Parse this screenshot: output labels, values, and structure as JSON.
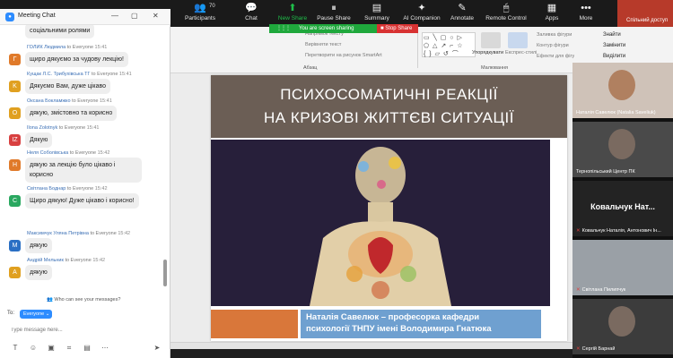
{
  "toolbar": {
    "participants_count": "70",
    "items": [
      {
        "label": "Participants",
        "icon": "👥"
      },
      {
        "label": "Chat",
        "icon": "💬"
      },
      {
        "label": "New Share",
        "icon": "⬆"
      },
      {
        "label": "Pause Share",
        "icon": "⏸"
      },
      {
        "label": "Summary",
        "icon": "▤"
      },
      {
        "label": "AI Companion",
        "icon": "✦"
      },
      {
        "label": "Annotate",
        "icon": "✎"
      },
      {
        "label": "Remote Control",
        "icon": "🖱"
      },
      {
        "label": "Apps",
        "icon": "▦"
      },
      {
        "label": "More",
        "icon": "•••"
      }
    ],
    "share_status": "You are screen sharing",
    "stop_share": "Stop Share",
    "accent": "#1fbf4a",
    "corner_text": "Спільний доступ"
  },
  "ribbon": {
    "para_items": [
      "Напрямок тексту",
      "Вирівняти текст",
      "Перетворити на рисунок SmartArt"
    ],
    "group_paragraph": "Абзац",
    "group_drawing": "Малювання",
    "arrange": "Упорядкувати",
    "quick_styles": "Експрес-стилі",
    "shape_fill": "Заливка фігури",
    "shape_outline": "Контур фігури",
    "shape_effects": "Ефекти для фігур",
    "find": "Знайти",
    "replace": "Замінити",
    "select": "Виділити"
  },
  "chat": {
    "title": "Meeting Chat",
    "messages": [
      {
        "initial": "",
        "color": "#e0a020",
        "sender": "",
        "to": "",
        "time": "",
        "text": "соціальними ролями"
      },
      {
        "initial": "Г",
        "color": "#e07a2a",
        "sender": "ГОЛИК Людмила",
        "to": "to Everyone",
        "time": "15:41",
        "text": "щиро дякуємо за чудову лекцію!"
      },
      {
        "initial": "K",
        "color": "#e0a020",
        "sender": "Кущак Л.С. Трибухівська ТГ",
        "to": "to Everyone",
        "time": "15:41",
        "text": "Дякуємо Вам, дуже цікаво"
      },
      {
        "initial": "О",
        "color": "#e0a020",
        "sender": "Оксана Бокламжко",
        "to": "to Everyone",
        "time": "15:41",
        "text": "дякую, змістовно та корисно"
      },
      {
        "initial": "IZ",
        "color": "#d84040",
        "sender": "Ilona Zolotnyk",
        "to": "to Everyone",
        "time": "15:41",
        "text": "Дякую"
      },
      {
        "initial": "Н",
        "color": "#e07a2a",
        "sender": "Неля Соболівська",
        "to": "to Everyone",
        "time": "15:42",
        "text": "дякую за лекцію було цікаво і корисно"
      },
      {
        "initial": "С",
        "color": "#2aa860",
        "sender": "Світлана Боднар",
        "to": "to Everyone",
        "time": "15:42",
        "text": "Щиро дякую! Дуже цікаво і корисно!"
      },
      {
        "initial": "М",
        "color": "#2a6fc4",
        "sender": "Максимчук Уляна Петрівна",
        "to": "to Everyone",
        "time": "15:42",
        "text": "дякую"
      },
      {
        "initial": "А",
        "color": "#e0a020",
        "sender": "Андрій Мельник",
        "to": "to Everyone",
        "time": "15:42",
        "text": "дякую"
      }
    ],
    "who_can_see": "Who can see your messages?",
    "to_label": "To:",
    "recipient": "Everyone",
    "input_placeholder": "Type message here..."
  },
  "slide": {
    "title_line1": "ПСИХОСОМАТИЧНІ РЕАКЦІЇ",
    "title_line2": "НА КРИЗОВІ ЖИТТЄВІ СИТУАЦІЇ",
    "name_line1": "Наталія Савелюк – професорка кафедри",
    "name_line2": "психології ТНПУ імені Володимира Гнатюка"
  },
  "participants": [
    {
      "name": "Наталія Савелюк (Natalia Saveliuk)",
      "big": "",
      "bg": "#cfc2b8",
      "muted": false
    },
    {
      "name": "Тернопільський Центр ПК",
      "big": "",
      "bg": "#4a4a4a",
      "muted": false
    },
    {
      "name": "Ковальчук Наталія, Антонович Ін...",
      "big": "Ковальчук Нат...",
      "bg": "#232323",
      "muted": true
    },
    {
      "name": "Світлана Пилипчук",
      "big": "",
      "bg": "#9aa0a6",
      "muted": true
    },
    {
      "name": "Сергій Барнай",
      "big": "",
      "bg": "#3c3c3c",
      "muted": true
    }
  ]
}
